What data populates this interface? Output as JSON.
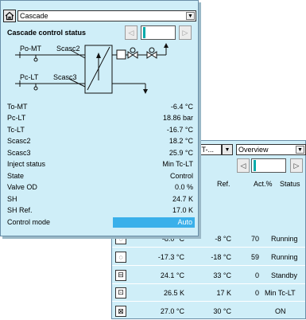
{
  "cascade": {
    "home_icon": "home-icon",
    "selector_value": "Cascade",
    "title": "Cascade control status",
    "diagram": {
      "po_mt": "Po-MT",
      "scasc2": "Scasc2",
      "pc_lt": "Pc-LT",
      "scasc3": "Scasc3"
    },
    "rows": [
      {
        "label": "To-MT",
        "value": "-6.4 °C"
      },
      {
        "label": "Pc-LT",
        "value": "18.86 bar"
      },
      {
        "label": "Tc-LT",
        "value": "-16.7 °C"
      },
      {
        "label": "Scasc2",
        "value": "18.2 °C"
      },
      {
        "label": "Scasc3",
        "value": "25.9 °C"
      },
      {
        "label": "Inject status",
        "value": "Min Tc-LT"
      },
      {
        "label": "State",
        "value": "Control"
      },
      {
        "label": "Valve OD",
        "value": "0.0 %"
      },
      {
        "label": "SH",
        "value": "24.7 K"
      },
      {
        "label": "SH Ref.",
        "value": "17.0 K"
      },
      {
        "label": "Control mode",
        "value": "Auto"
      }
    ]
  },
  "overview": {
    "group_select": "MT-...",
    "view_select": "Overview",
    "headers": {
      "ref": "Ref.",
      "act": "Act.%",
      "status": "Status"
    },
    "rows": [
      {
        "icon": "compressor-icon",
        "value": "-8.0 °C",
        "ref": "-8 °C",
        "act": "70",
        "status": "Running"
      },
      {
        "icon": "compressor-icon",
        "value": "-17.3 °C",
        "ref": "-18 °C",
        "act": "59",
        "status": "Running"
      },
      {
        "icon": "cabinet-icon",
        "value": "24.1 °C",
        "ref": "33 °C",
        "act": "0",
        "status": "Standby"
      },
      {
        "icon": "condenser-icon",
        "value": "26.5 K",
        "ref": "17 K",
        "act": "0",
        "status": "Min Tc-LT"
      },
      {
        "icon": "heat-exchanger-icon",
        "value": "27.0 °C",
        "ref": "30 °C",
        "act": "",
        "status": "ON"
      }
    ]
  }
}
